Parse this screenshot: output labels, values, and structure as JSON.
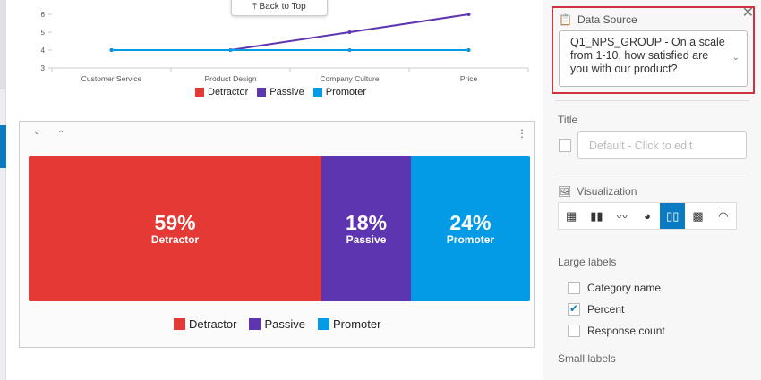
{
  "line_chart": {
    "categories": [
      "Customer Service",
      "Product Design",
      "Company Culture",
      "Price"
    ],
    "yticks": [
      3,
      4,
      5,
      6
    ],
    "ylim": [
      3,
      6
    ],
    "series": [
      {
        "name": "Detractor",
        "color": "#e53935",
        "values": [
          4,
          4,
          4,
          4
        ]
      },
      {
        "name": "Passive",
        "color": "#5e35b1",
        "values": [
          4,
          4,
          5,
          6
        ]
      },
      {
        "name": "Promoter",
        "color": "#039be5",
        "values": [
          4,
          4,
          4,
          4
        ]
      }
    ],
    "back_to_top": "⤒ Back to Top"
  },
  "breakdown": {
    "segments": [
      {
        "percent": "59%",
        "label": "Detractor",
        "value": 59,
        "color": "#e53935"
      },
      {
        "percent": "18%",
        "label": "Passive",
        "value": 18,
        "color": "#5e35b1"
      },
      {
        "percent": "24%",
        "label": "Promoter",
        "value": 24,
        "color": "#039be5"
      }
    ]
  },
  "panel": {
    "data_source_label": "Data Source",
    "data_source_value": "Q1_NPS_GROUP - On a scale from 1-10, how satisfied are you with our product?",
    "title_label": "Title",
    "title_placeholder": "Default - Click to edit",
    "visualization_label": "Visualization",
    "viz_types": [
      "table",
      "bar",
      "line",
      "pie",
      "breakdown-bar",
      "heatmap",
      "gauge"
    ],
    "large_labels": "Large labels",
    "options": [
      {
        "label": "Category name",
        "checked": false
      },
      {
        "label": "Percent",
        "checked": true
      },
      {
        "label": "Response count",
        "checked": false
      }
    ],
    "small_labels": "Small labels"
  }
}
